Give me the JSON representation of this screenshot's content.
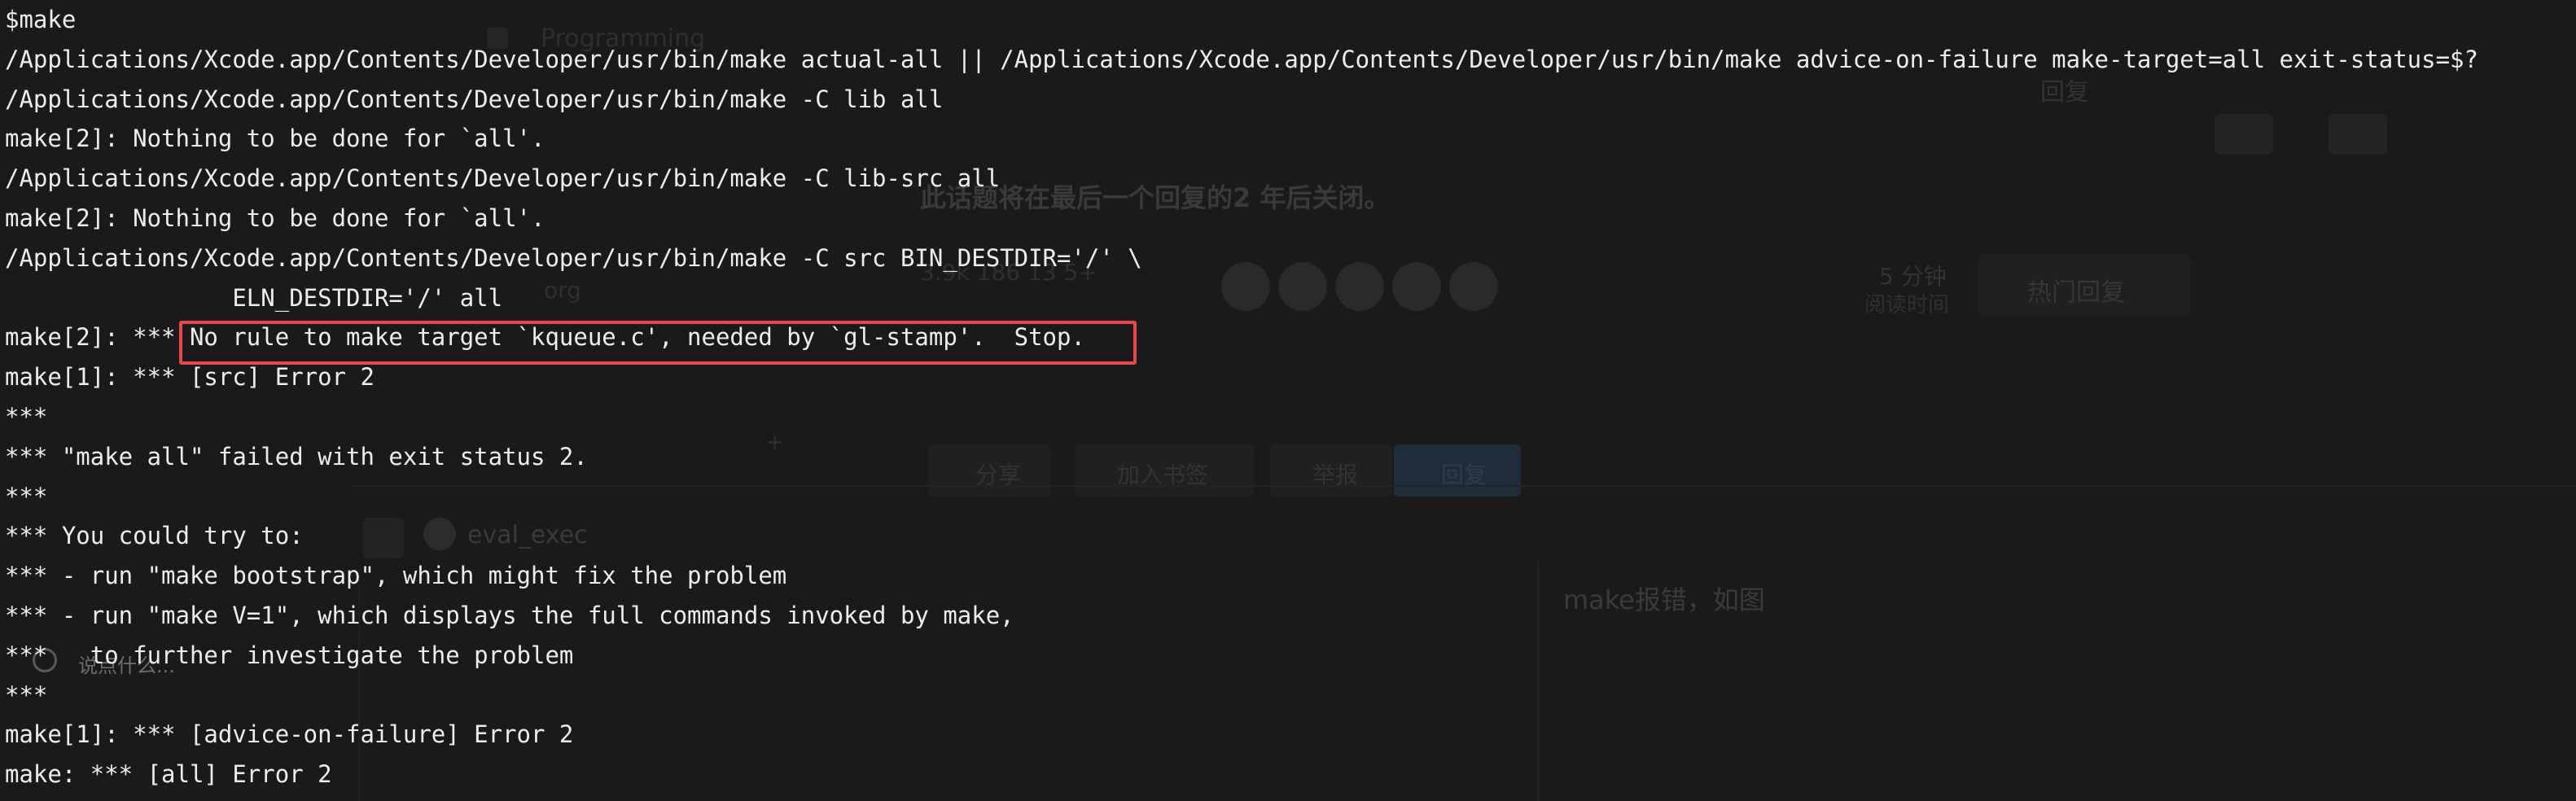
{
  "terminal": {
    "lines": [
      "$make",
      "/Applications/Xcode.app/Contents/Developer/usr/bin/make actual-all || /Applications/Xcode.app/Contents/Developer/usr/bin/make advice-on-failure make-target=all exit-status=$?",
      "/Applications/Xcode.app/Contents/Developer/usr/bin/make -C lib all",
      "make[2]: Nothing to be done for `all'.",
      "/Applications/Xcode.app/Contents/Developer/usr/bin/make -C lib-src all",
      "make[2]: Nothing to be done for `all'.",
      "/Applications/Xcode.app/Contents/Developer/usr/bin/make -C src BIN_DESTDIR='/' \\",
      "                ELN_DESTDIR='/' all",
      "make[2]: *** No rule to make target `kqueue.c', needed by `gl-stamp'.  Stop.",
      "make[1]: *** [src] Error 2",
      "***",
      "*** \"make all\" failed with exit status 2.",
      "***",
      "*** You could try to:",
      "*** - run \"make bootstrap\", which might fix the problem",
      "*** - run \"make V=1\", which displays the full commands invoked by make,",
      "***   to further investigate the problem",
      "***",
      "make[1]: *** [advice-on-failure] Error 2",
      "make: *** [all] Error 2"
    ]
  },
  "background_page": {
    "topic_title": "Programming",
    "reply_label": "回复",
    "closing_notice": "此话题将在最后一个回复的2 年后关闭。",
    "stats": "3.9k   186   13   5+",
    "read_time": "5 分钟",
    "read_time_label": "阅读时间",
    "hot_replies_button": "热门回复",
    "org_label": "org",
    "actions": [
      "分享",
      "加入书签",
      "举报"
    ],
    "reply_button": "回复",
    "username": "eval_exec",
    "post_text": "make报错，如图",
    "chat_placeholder": "说点什么..."
  },
  "colors": {
    "terminal_bg": "#1a1a1a",
    "terminal_text": "#ededed",
    "highlight_border": "#e8484a"
  }
}
